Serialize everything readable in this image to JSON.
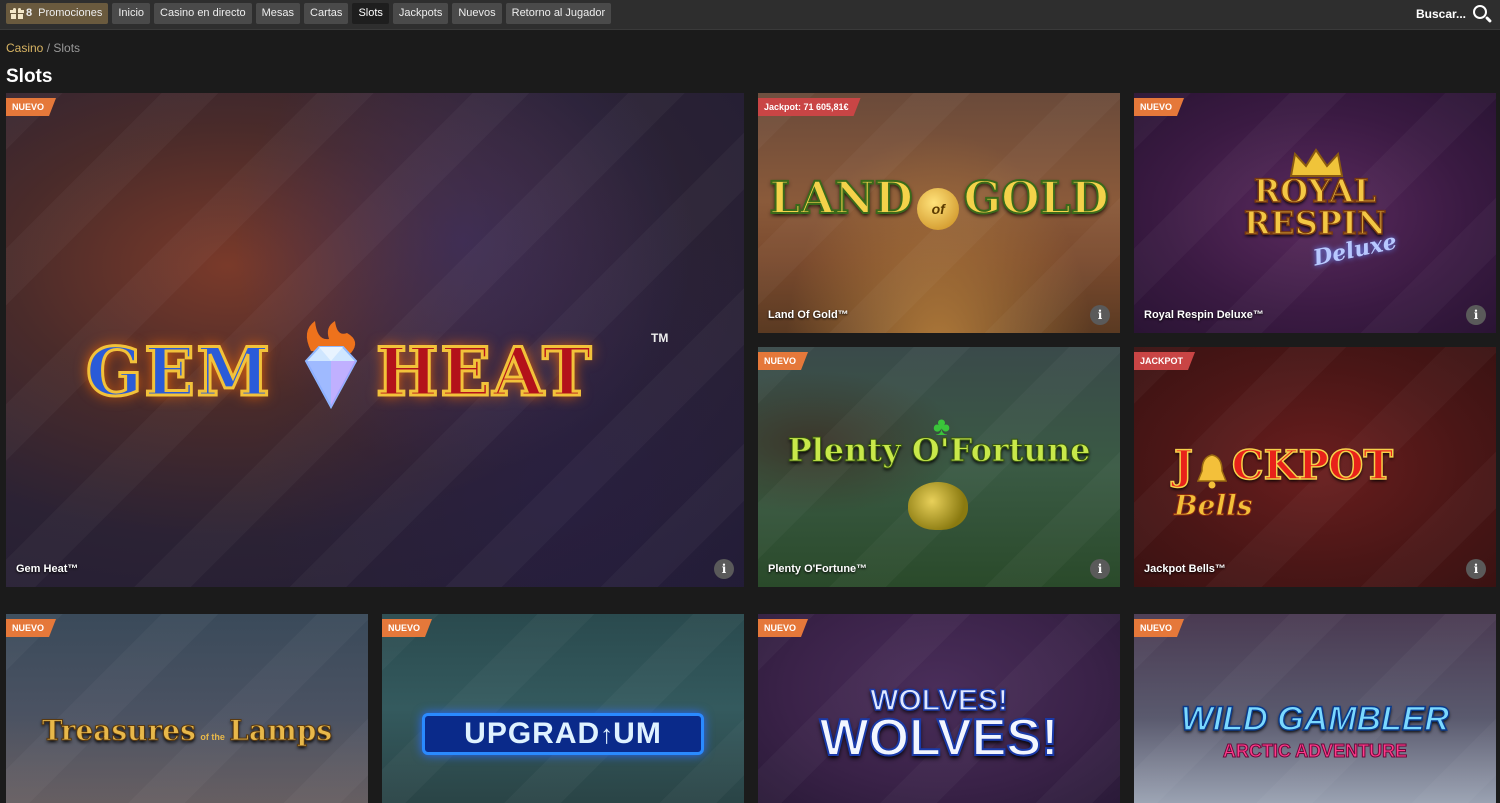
{
  "nav": {
    "promo_count": "8",
    "items": [
      "Promociones",
      "Inicio",
      "Casino en directo",
      "Mesas",
      "Cartas",
      "Slots",
      "Jackpots",
      "Nuevos",
      "Retorno al Jugador"
    ]
  },
  "search": {
    "label": "Buscar..."
  },
  "breadcrumb": {
    "root": "Casino",
    "separator": " / ",
    "current": "Slots"
  },
  "page": {
    "title": "Slots"
  },
  "info_label": "i",
  "games": [
    {
      "name": "Gem Heat™",
      "badge": "NUEVO",
      "logo_1": "GEM",
      "logo_2": "HEAT",
      "tm": "TM"
    },
    {
      "name": "Land Of Gold™",
      "badge": "Jackpot: 71 605,81€",
      "logo_1": "LAND",
      "logo_2": "of",
      "logo_3": "GOLD"
    },
    {
      "name": "Royal Respin Deluxe™",
      "badge": "NUEVO",
      "logo_1": "ROYAL",
      "logo_2": "RESPIN",
      "logo_3": "Deluxe"
    },
    {
      "name": "Plenty O'Fortune™",
      "badge": "NUEVO",
      "logo_1": "Plenty O'Fortune"
    },
    {
      "name": "Jackpot Bells™",
      "badge": "JACKPOT",
      "logo_1": "J",
      "logo_2": "CKPOT",
      "logo_3": "Bells"
    },
    {
      "name": "",
      "badge": "NUEVO",
      "logo_1": "Treasures",
      "logo_2": "of the",
      "logo_3": "Lamps"
    },
    {
      "name": "",
      "badge": "NUEVO",
      "logo_1": "UPGRAD",
      "logo_2": "UM"
    },
    {
      "name": "",
      "badge": "NUEVO",
      "logo_1": "WOLVES!",
      "logo_2": "WOLVES!"
    },
    {
      "name": "",
      "badge": "NUEVO",
      "logo_1": "WILD GAMBLER",
      "logo_2": "ARCTIC ADVENTURE"
    }
  ],
  "colors": {
    "badge_nuevo": "#e5783a",
    "badge_jackpot": "#c94545",
    "breadcrumb_link": "#d8b463",
    "topbar": "#2e2e2e"
  }
}
